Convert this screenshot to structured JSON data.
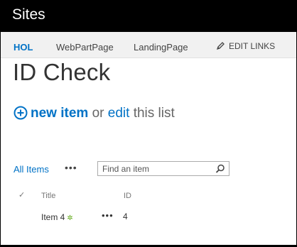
{
  "header": {
    "brand": "Sites"
  },
  "nav": {
    "items": [
      {
        "label": "HOL",
        "active": true
      },
      {
        "label": "WebPartPage",
        "active": false
      },
      {
        "label": "LandingPage",
        "active": false
      }
    ],
    "edit_links": "EDIT LINKS"
  },
  "page": {
    "title": "ID Check"
  },
  "commands": {
    "new_item": "new item",
    "or": "or",
    "edit": "edit",
    "this_list": "this list"
  },
  "view": {
    "name": "All Items",
    "more": "•••",
    "search_placeholder": "Find an item"
  },
  "table": {
    "columns": [
      "✓",
      "Title",
      "ID"
    ],
    "rows": [
      {
        "title": "Item 4",
        "new_marker": "✲",
        "menu": "•••",
        "id": "4"
      }
    ]
  },
  "colors": {
    "accent": "#0072c6",
    "new_marker": "#60a917",
    "topbar": "#000000"
  }
}
